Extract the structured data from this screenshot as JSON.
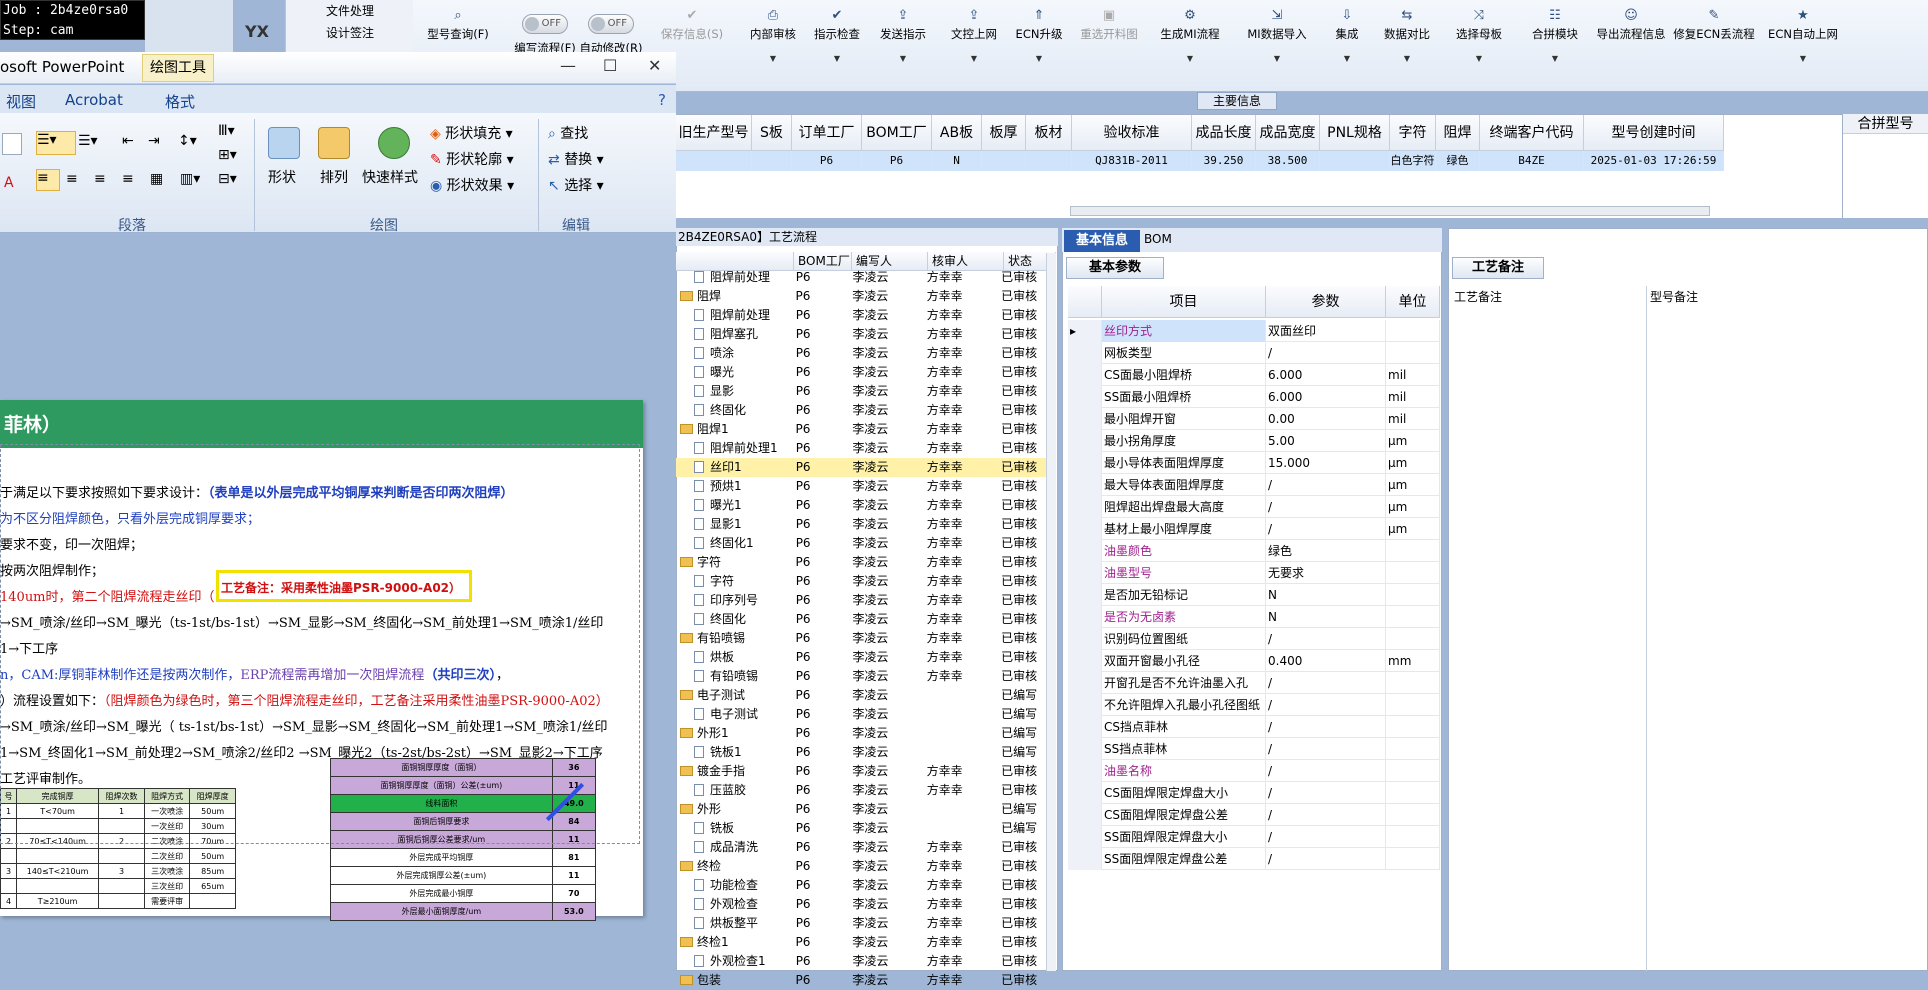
{
  "job_panel": {
    "line1": "Job : 2b4ze0rsa0",
    "line2": "Step: cam"
  },
  "desk": {
    "label": "YX",
    "menu": [
      "文件处理",
      "设计签注"
    ]
  },
  "toolbar": {
    "buttons": [
      {
        "icon": "search-icon",
        "label": "型号查询(F)",
        "dd": true
      },
      {
        "icon": "toggle",
        "label": "编写流程(F)",
        "dd": false,
        "toggle": "OFF"
      },
      {
        "icon": "toggle",
        "label": "自动修改(R)",
        "dd": false,
        "toggle": "OFF"
      },
      {
        "icon": "check-icon",
        "label": "保存信息(S)",
        "dd": false,
        "disabled": true
      },
      {
        "icon": "print-icon",
        "label": "内部审核",
        "dd": true
      },
      {
        "icon": "check-icon",
        "label": "指示检查",
        "dd": true
      },
      {
        "icon": "upload-icon",
        "label": "发送指示",
        "dd": true
      },
      {
        "icon": "upload-icon",
        "label": "文控上网",
        "dd": true
      },
      {
        "icon": "up-icon",
        "label": "ECN升级",
        "dd": true
      },
      {
        "icon": "image-icon",
        "label": "重选开料图",
        "dd": false,
        "disabled": true
      },
      {
        "icon": "gear-icon",
        "label": "生成MI流程",
        "dd": true
      },
      {
        "icon": "import-icon",
        "label": "MI数据导入",
        "dd": true
      },
      {
        "icon": "download-icon",
        "label": "集成",
        "dd": true
      },
      {
        "icon": "compare-icon",
        "label": "数据对比",
        "dd": true
      },
      {
        "icon": "shuffle-icon",
        "label": "选择母板",
        "dd": true
      },
      {
        "icon": "list-icon",
        "label": "合拼模块",
        "dd": true
      },
      {
        "icon": "smile-icon",
        "label": "导出流程信息",
        "dd": false
      },
      {
        "icon": "wrench-icon",
        "label": "修复ECN丢流程",
        "dd": false
      },
      {
        "icon": "star-icon",
        "label": "ECN自动上网",
        "dd": true
      }
    ]
  },
  "main_info": {
    "label": "主要信息"
  },
  "upper_grid": {
    "columns": [
      "旧生产型号",
      "S板",
      "订单工厂",
      "BOM工厂",
      "AB板",
      "板厚",
      "板材",
      "验收标准",
      "成品长度",
      "成品宽度",
      "PNL规格",
      "字符",
      "阻焊",
      "终端客户代码",
      "型号创建时间"
    ],
    "row": [
      "",
      "",
      "P6",
      "P6",
      "N",
      "",
      "",
      "QJ831B-2011",
      "39.250",
      "38.500",
      "",
      "白色字符",
      "绿色",
      "B4ZE",
      "2025-01-03 17:26:59"
    ],
    "extra_col": "合拼型号"
  },
  "ppt": {
    "title": "osoft PowerPoint",
    "tool_tab": "绘图工具",
    "tabs": [
      "视图",
      "Acrobat",
      "格式"
    ],
    "groups": [
      "段落",
      "绘图",
      "编辑"
    ],
    "draw_btns": [
      "形状",
      "排列",
      "快速样式"
    ],
    "shape_opts": [
      "形状填充",
      "形状轮廓",
      "形状效果"
    ],
    "edit_opts": [
      "查找",
      "替换",
      "选择"
    ]
  },
  "slide": {
    "title": "菲林）",
    "lines": [
      {
        "parts": [
          {
            "t": "于满足以下要求按照如下要求设计：",
            "c": ""
          },
          {
            "t": "（表单是以外层完成平均铜厚来判断是否印两次阻焊）",
            "c": "blue bold"
          }
        ]
      },
      {
        "parts": [
          {
            "t": "为不区分阻焊颜色，只看外层完成铜厚要求；",
            "c": "blue"
          }
        ]
      },
      {
        "parts": [
          {
            "t": "要求不变，印一次阻焊；",
            "c": ""
          }
        ]
      },
      {
        "parts": [
          {
            "t": "按两次阻焊制作；",
            "c": ""
          }
        ]
      },
      {
        "parts": [
          {
            "t": "140um时，第二个阻焊流程走丝印（",
            "c": "red"
          }
        ]
      },
      {
        "parts": [
          {
            "t": "→SM_喷涂/丝印→SM_曝光（ts-1st/bs-1st）→SM_显影→SM_终固化→SM_前处理1→SM_喷涂1/丝印",
            "c": ""
          }
        ]
      },
      {
        "parts": [
          {
            "t": "1→下工序",
            "c": ""
          }
        ]
      },
      {
        "parts": [
          {
            "t": "n，CAM:厚铜菲林制作还是按两次制作，",
            "c": "blue"
          },
          {
            "t": "ERP流程需再增加一次阻焊流程",
            "c": "purple"
          },
          {
            "t": "（共印三次）",
            "c": "blue bold"
          },
          {
            "t": "，",
            "c": ""
          }
        ]
      },
      {
        "parts": [
          {
            "t": "）流程设置如下：",
            "c": ""
          },
          {
            "t": "（阻焊颜色为绿色时，第三个阻焊流程走丝印，工艺备注采用柔性油墨PSR-9000-A02）",
            "c": "red"
          }
        ]
      },
      {
        "parts": [
          {
            "t": "→SM_喷涂/丝印→SM_曝光（ ts-1st/bs-1st）→SM_显影→SM_终固化→SM_前处理1→SM_喷涂1/丝印",
            "c": ""
          }
        ]
      },
      {
        "parts": [
          {
            "t": "1→SM_终固化1→SM_前处理2→SM_喷涂2/丝印2 →SM_曝光2（ts-2st/bs-2st）→SM_显影2→下工序",
            "c": ""
          }
        ]
      },
      {
        "parts": [
          {
            "t": "工艺评审制作。",
            "c": ""
          }
        ]
      }
    ],
    "highlight": "工艺备注：采用柔性油墨PSR-9000-A02）",
    "left_table": [
      [
        "号",
        "完成铜厚",
        "阻焊次数",
        "阻焊方式",
        "阻焊厚度"
      ],
      [
        "1",
        "T<70um",
        "1",
        "一次喷涂",
        "50um"
      ],
      [
        "",
        "",
        "",
        "一次丝印",
        "30um"
      ],
      [
        "2",
        "70≤T<140um",
        "2",
        "二次喷涂",
        "70um"
      ],
      [
        "",
        "",
        "",
        "二次丝印",
        "50um"
      ],
      [
        "3",
        "140≤T<210um",
        "3",
        "三次喷涂",
        "85um"
      ],
      [
        "",
        "",
        "",
        "三次丝印",
        "65um"
      ],
      [
        "4",
        "T≥210um",
        "",
        "需要评审",
        ""
      ]
    ],
    "right_table": [
      [
        "面铜铜厚厚度（面铜）",
        "36"
      ],
      [
        "面铜铜厚厚度（面铜）公差(±um)",
        "11"
      ],
      [
        "线料面积",
        "49.0"
      ],
      [
        "面铜后铜厚要求",
        "84"
      ],
      [
        "面铜后铜厚公差要求/um",
        "11"
      ],
      [
        "外层完成平均铜厚",
        "81"
      ],
      [
        "外层完成铜厚公差(±um)",
        "11"
      ],
      [
        "外层完成最小铜厚",
        "70"
      ],
      [
        "外层最小面铜厚度/um",
        "53.0"
      ]
    ]
  },
  "process": {
    "title": "2B4ZE0RSA0】工艺流程",
    "columns": [
      "",
      "BOM工厂",
      "编写人",
      "核审人",
      "状态"
    ],
    "rows": [
      {
        "indent": 1,
        "type": "doc",
        "name": "阻焊前处理",
        "bom": "P6",
        "author": "李凌云",
        "reviewer": "方幸幸",
        "status": "已审核"
      },
      {
        "indent": 0,
        "type": "folder",
        "name": "阻焊",
        "bom": "P6",
        "author": "李凌云",
        "reviewer": "方幸幸",
        "status": "已审核"
      },
      {
        "indent": 1,
        "type": "doc",
        "name": "阻焊前处理",
        "bom": "P6",
        "author": "李凌云",
        "reviewer": "方幸幸",
        "status": "已审核"
      },
      {
        "indent": 1,
        "type": "doc",
        "name": "阻焊塞孔",
        "bom": "P6",
        "author": "李凌云",
        "reviewer": "方幸幸",
        "status": "已审核"
      },
      {
        "indent": 1,
        "type": "doc",
        "name": "喷涂",
        "bom": "P6",
        "author": "李凌云",
        "reviewer": "方幸幸",
        "status": "已审核"
      },
      {
        "indent": 1,
        "type": "doc",
        "name": "曝光",
        "bom": "P6",
        "author": "李凌云",
        "reviewer": "方幸幸",
        "status": "已审核"
      },
      {
        "indent": 1,
        "type": "doc",
        "name": "显影",
        "bom": "P6",
        "author": "李凌云",
        "reviewer": "方幸幸",
        "status": "已审核"
      },
      {
        "indent": 1,
        "type": "doc",
        "name": "终固化",
        "bom": "P6",
        "author": "李凌云",
        "reviewer": "方幸幸",
        "status": "已审核"
      },
      {
        "indent": 0,
        "type": "folder",
        "name": "阻焊1",
        "bom": "P6",
        "author": "李凌云",
        "reviewer": "方幸幸",
        "status": "已审核"
      },
      {
        "indent": 1,
        "type": "doc",
        "name": "阻焊前处理1",
        "bom": "P6",
        "author": "李凌云",
        "reviewer": "方幸幸",
        "status": "已审核"
      },
      {
        "indent": 1,
        "type": "doc",
        "name": "丝印1",
        "bom": "P6",
        "author": "李凌云",
        "reviewer": "方幸幸",
        "status": "已审核",
        "selected": true
      },
      {
        "indent": 1,
        "type": "doc",
        "name": "预烘1",
        "bom": "P6",
        "author": "李凌云",
        "reviewer": "方幸幸",
        "status": "已审核"
      },
      {
        "indent": 1,
        "type": "doc",
        "name": "曝光1",
        "bom": "P6",
        "author": "李凌云",
        "reviewer": "方幸幸",
        "status": "已审核"
      },
      {
        "indent": 1,
        "type": "doc",
        "name": "显影1",
        "bom": "P6",
        "author": "李凌云",
        "reviewer": "方幸幸",
        "status": "已审核"
      },
      {
        "indent": 1,
        "type": "doc",
        "name": "终固化1",
        "bom": "P6",
        "author": "李凌云",
        "reviewer": "方幸幸",
        "status": "已审核"
      },
      {
        "indent": 0,
        "type": "folder",
        "name": "字符",
        "bom": "P6",
        "author": "李凌云",
        "reviewer": "方幸幸",
        "status": "已审核"
      },
      {
        "indent": 1,
        "type": "doc",
        "name": "字符",
        "bom": "P6",
        "author": "李凌云",
        "reviewer": "方幸幸",
        "status": "已审核"
      },
      {
        "indent": 1,
        "type": "doc",
        "name": "印序列号",
        "bom": "P6",
        "author": "李凌云",
        "reviewer": "方幸幸",
        "status": "已审核"
      },
      {
        "indent": 1,
        "type": "doc",
        "name": "终固化",
        "bom": "P6",
        "author": "李凌云",
        "reviewer": "方幸幸",
        "status": "已审核"
      },
      {
        "indent": 0,
        "type": "folder",
        "name": "有铅喷锡",
        "bom": "P6",
        "author": "李凌云",
        "reviewer": "方幸幸",
        "status": "已审核"
      },
      {
        "indent": 1,
        "type": "doc",
        "name": "烘板",
        "bom": "P6",
        "author": "李凌云",
        "reviewer": "方幸幸",
        "status": "已审核"
      },
      {
        "indent": 1,
        "type": "doc",
        "name": "有铅喷锡",
        "bom": "P6",
        "author": "李凌云",
        "reviewer": "方幸幸",
        "status": "已审核"
      },
      {
        "indent": 0,
        "type": "folder",
        "name": "电子测试",
        "bom": "P6",
        "author": "李凌云",
        "reviewer": "",
        "status": "已编写"
      },
      {
        "indent": 1,
        "type": "doc",
        "name": "电子测试",
        "bom": "P6",
        "author": "李凌云",
        "reviewer": "",
        "status": "已编写"
      },
      {
        "indent": 0,
        "type": "folder",
        "name": "外形1",
        "bom": "P6",
        "author": "李凌云",
        "reviewer": "",
        "status": "已编写"
      },
      {
        "indent": 1,
        "type": "doc",
        "name": "铣板1",
        "bom": "P6",
        "author": "李凌云",
        "reviewer": "",
        "status": "已编写"
      },
      {
        "indent": 0,
        "type": "folder",
        "name": "镀金手指",
        "bom": "P6",
        "author": "李凌云",
        "reviewer": "方幸幸",
        "status": "已审核"
      },
      {
        "indent": 1,
        "type": "doc",
        "name": "压蓝胶",
        "bom": "P6",
        "author": "李凌云",
        "reviewer": "方幸幸",
        "status": "已审核"
      },
      {
        "indent": 0,
        "type": "folder",
        "name": "外形",
        "bom": "P6",
        "author": "李凌云",
        "reviewer": "",
        "status": "已编写"
      },
      {
        "indent": 1,
        "type": "doc",
        "name": "铣板",
        "bom": "P6",
        "author": "李凌云",
        "reviewer": "",
        "status": "已编写"
      },
      {
        "indent": 1,
        "type": "doc",
        "name": "成品清洗",
        "bom": "P6",
        "author": "李凌云",
        "reviewer": "方幸幸",
        "status": "已审核"
      },
      {
        "indent": 0,
        "type": "folder",
        "name": "终检",
        "bom": "P6",
        "author": "李凌云",
        "reviewer": "方幸幸",
        "status": "已审核"
      },
      {
        "indent": 1,
        "type": "doc",
        "name": "功能检查",
        "bom": "P6",
        "author": "李凌云",
        "reviewer": "方幸幸",
        "status": "已审核"
      },
      {
        "indent": 1,
        "type": "doc",
        "name": "外观检查",
        "bom": "P6",
        "author": "李凌云",
        "reviewer": "方幸幸",
        "status": "已审核"
      },
      {
        "indent": 1,
        "type": "doc",
        "name": "烘板整平",
        "bom": "P6",
        "author": "李凌云",
        "reviewer": "方幸幸",
        "status": "已审核"
      },
      {
        "indent": 0,
        "type": "folder",
        "name": "终检1",
        "bom": "P6",
        "author": "李凌云",
        "reviewer": "方幸幸",
        "status": "已审核"
      },
      {
        "indent": 1,
        "type": "doc",
        "name": "外观检查1",
        "bom": "P6",
        "author": "李凌云",
        "reviewer": "方幸幸",
        "status": "已审核"
      },
      {
        "indent": 0,
        "type": "folder",
        "name": "包装",
        "bom": "P6",
        "author": "李凌云",
        "reviewer": "方幸幸",
        "status": "已审核"
      }
    ]
  },
  "basic": {
    "tab1": "基本信息",
    "tab2": "BOM",
    "sub": "基本参数",
    "columns": [
      "项目",
      "参数",
      "单位"
    ],
    "rows": [
      {
        "item": "丝印方式",
        "value": "双面丝印",
        "unit": "",
        "hl": true,
        "cur": true
      },
      {
        "item": "网板类型",
        "value": "/",
        "unit": ""
      },
      {
        "item": "CS面最小阻焊桥",
        "value": "6.000",
        "unit": "mil"
      },
      {
        "item": "SS面最小阻焊桥",
        "value": "6.000",
        "unit": "mil"
      },
      {
        "item": "最小阻焊开窗",
        "value": "0.00",
        "unit": "mil"
      },
      {
        "item": "最小拐角厚度",
        "value": "5.00",
        "unit": "μm"
      },
      {
        "item": "最小导体表面阻焊厚度",
        "value": "15.000",
        "unit": "μm"
      },
      {
        "item": "最大导体表面阻焊厚度",
        "value": "/",
        "unit": "μm"
      },
      {
        "item": "阻焊超出焊盘最大高度",
        "value": "/",
        "unit": "μm"
      },
      {
        "item": "基材上最小阻焊厚度",
        "value": "/",
        "unit": "μm"
      },
      {
        "item": "油墨颜色",
        "value": "绿色",
        "unit": "",
        "hl": true
      },
      {
        "item": "油墨型号",
        "value": "无要求",
        "unit": "",
        "hl": true
      },
      {
        "item": "是否加无铅标记",
        "value": "N",
        "unit": ""
      },
      {
        "item": "是否为无卤素",
        "value": "N",
        "unit": "",
        "hl": true
      },
      {
        "item": "识别码位置图纸",
        "value": "/",
        "unit": ""
      },
      {
        "item": "双面开窗最小孔径",
        "value": "0.400",
        "unit": "mm"
      },
      {
        "item": "开窗孔是否不允许油墨入孔",
        "value": "/",
        "unit": ""
      },
      {
        "item": "不允许阻焊入孔最小孔径图纸",
        "value": "/",
        "unit": ""
      },
      {
        "item": "CS挡点菲林",
        "value": "/",
        "unit": ""
      },
      {
        "item": "SS挡点菲林",
        "value": "/",
        "unit": ""
      },
      {
        "item": "油墨名称",
        "value": "/",
        "unit": "",
        "hl": true
      },
      {
        "item": "CS面阻焊限定焊盘大小",
        "value": "/",
        "unit": ""
      },
      {
        "item": "CS面阻焊限定焊盘公差",
        "value": "/",
        "unit": ""
      },
      {
        "item": "SS面阻焊限定焊盘大小",
        "value": "/",
        "unit": ""
      },
      {
        "item": "SS面阻焊限定焊盘公差",
        "value": "/",
        "unit": ""
      }
    ]
  },
  "note": {
    "tab": "工艺备注",
    "col1": "工艺备注",
    "col2": "型号备注"
  },
  "colors": {
    "accent": "#2a5db0",
    "selected_row": "#fff2a8",
    "highlight_text": "#a0208f"
  }
}
